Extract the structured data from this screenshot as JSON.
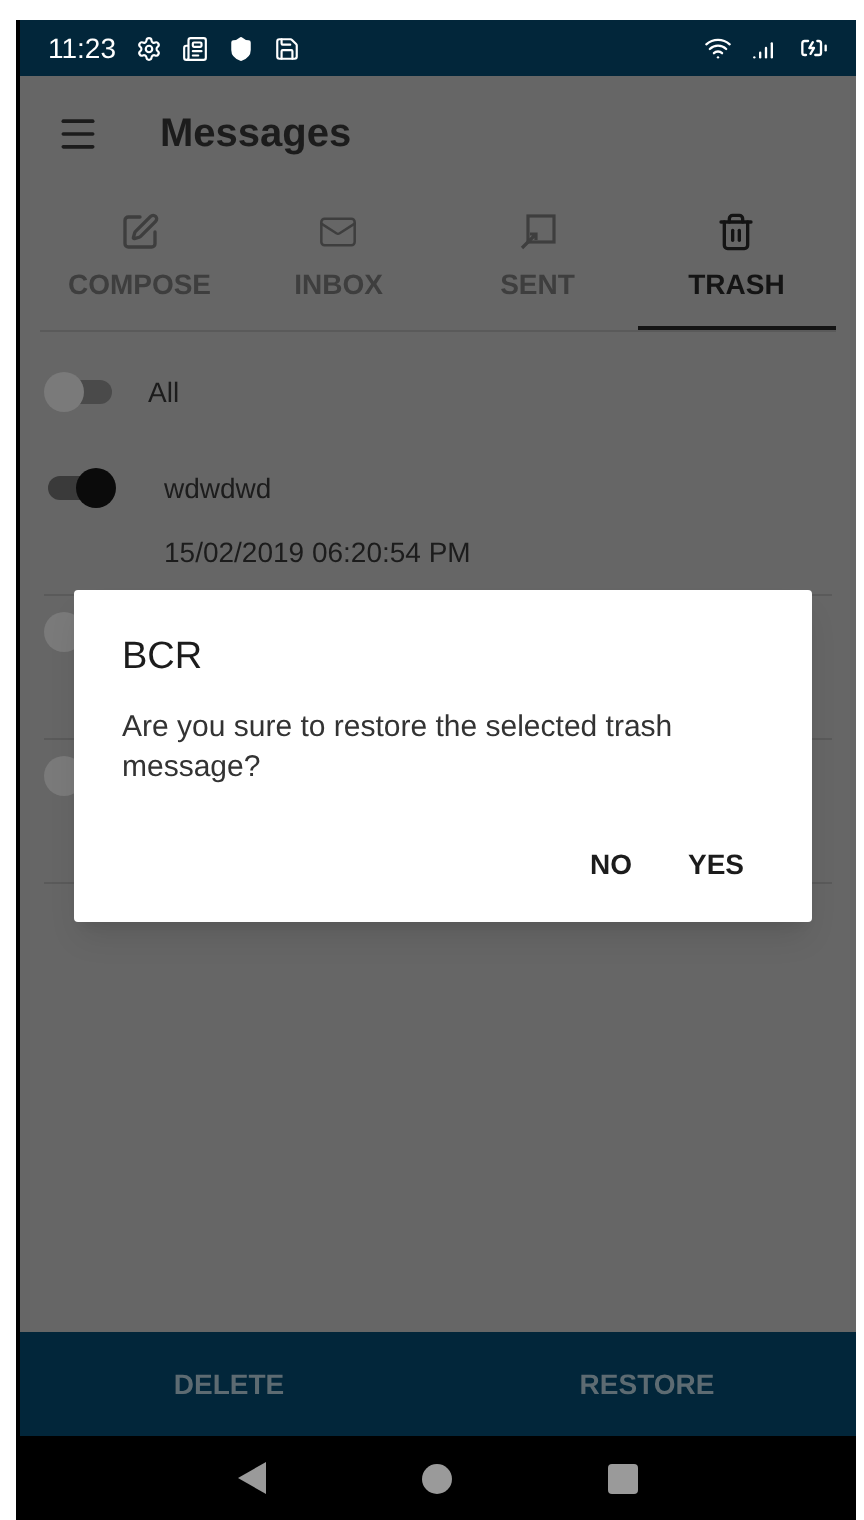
{
  "status_bar": {
    "time": "11:23"
  },
  "toolbar": {
    "title": "Messages"
  },
  "tabs": [
    {
      "label": "COMPOSE",
      "kind": "compose",
      "selected": false
    },
    {
      "label": "INBOX",
      "kind": "inbox",
      "selected": false
    },
    {
      "label": "SENT",
      "kind": "sent",
      "selected": false
    },
    {
      "label": "TRASH",
      "kind": "trash",
      "selected": true
    }
  ],
  "select_all": {
    "label": "All",
    "on": false
  },
  "messages": [
    {
      "sender": "wdwdwd",
      "time": "15/02/2019 06:20:54 PM",
      "on": true
    },
    {
      "on": false
    },
    {
      "on": false
    }
  ],
  "dialog": {
    "title": "BCR",
    "message": "Are you sure to restore the selected trash message?",
    "buttons": [
      "NO",
      "YES"
    ]
  },
  "bottom_bar": {
    "buttons": [
      "DELETE",
      "RESTORE"
    ]
  }
}
